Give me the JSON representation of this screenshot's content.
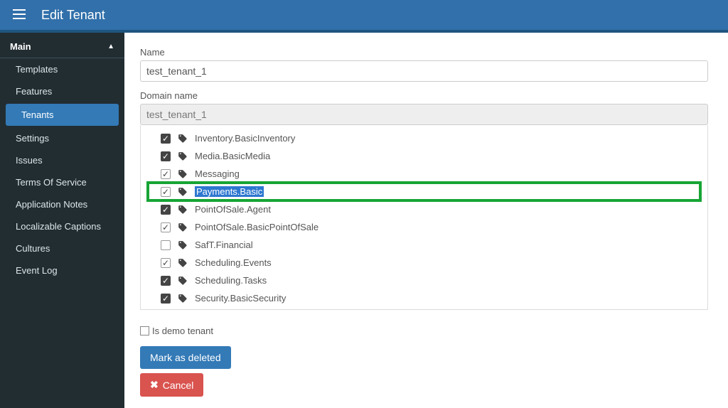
{
  "topbar": {
    "title": "Edit Tenant"
  },
  "sidebar": {
    "section": "Main",
    "items": [
      {
        "label": "Templates",
        "active": false
      },
      {
        "label": "Features",
        "active": false
      },
      {
        "label": "Tenants",
        "active": true
      },
      {
        "label": "Settings",
        "active": false
      },
      {
        "label": "Issues",
        "active": false
      },
      {
        "label": "Terms Of Service",
        "active": false
      },
      {
        "label": "Application Notes",
        "active": false
      },
      {
        "label": "Localizable Captions",
        "active": false
      },
      {
        "label": "Cultures",
        "active": false
      },
      {
        "label": "Event Log",
        "active": false
      }
    ]
  },
  "form": {
    "name_label": "Name",
    "name_value": "test_tenant_1",
    "domain_label": "Domain name",
    "domain_value": "test_tenant_1",
    "features": [
      {
        "label": "Inventory.BasicInventory",
        "checked": true,
        "dark": true,
        "highlight": false
      },
      {
        "label": "Media.BasicMedia",
        "checked": true,
        "dark": true,
        "highlight": false
      },
      {
        "label": "Messaging",
        "checked": true,
        "dark": false,
        "highlight": false
      },
      {
        "label": "Payments.Basic",
        "checked": true,
        "dark": false,
        "highlight": true
      },
      {
        "label": "PointOfSale.Agent",
        "checked": true,
        "dark": true,
        "highlight": false
      },
      {
        "label": "PointOfSale.BasicPointOfSale",
        "checked": true,
        "dark": false,
        "highlight": false
      },
      {
        "label": "SafT.Financial",
        "checked": false,
        "dark": false,
        "highlight": false
      },
      {
        "label": "Scheduling.Events",
        "checked": true,
        "dark": false,
        "highlight": false
      },
      {
        "label": "Scheduling.Tasks",
        "checked": true,
        "dark": true,
        "highlight": false
      },
      {
        "label": "Security.BasicSecurity",
        "checked": true,
        "dark": true,
        "highlight": false
      }
    ],
    "is_demo_label": "Is demo tenant",
    "is_demo_checked": false,
    "buttons": {
      "mark_deleted": "Mark as deleted",
      "cancel": "Cancel"
    }
  }
}
